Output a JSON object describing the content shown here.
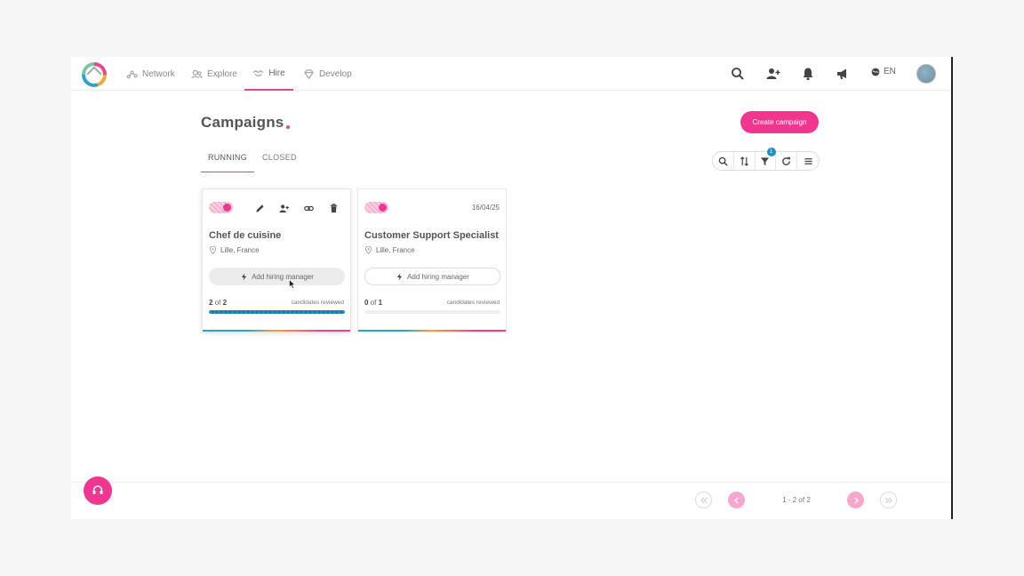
{
  "nav": {
    "items": [
      {
        "label": "Network",
        "icon": "network-icon"
      },
      {
        "label": "Explore",
        "icon": "users-icon"
      },
      {
        "label": "Hire",
        "icon": "handshake-icon"
      },
      {
        "label": "Develop",
        "icon": "diamond-icon"
      }
    ],
    "active": "Hire",
    "language": "EN"
  },
  "page": {
    "title": "Campaigns",
    "create_button": "Create campaign",
    "tabs": [
      "RUNNING",
      "CLOSED"
    ],
    "active_tab": "RUNNING",
    "filter_count": "1"
  },
  "campaigns": [
    {
      "title": "Chef de cuisine",
      "location": "Lille, France",
      "active": true,
      "date": "",
      "hiring_manager_label": "Add hiring manager",
      "reviewed": "2",
      "total": "2",
      "reviewed_label": "candidates reviewed",
      "progress": 1.0
    },
    {
      "title": "Customer Support Specialist",
      "location": "Lille, France",
      "active": true,
      "date": "16/04/25",
      "hiring_manager_label": "Add hiring manager",
      "reviewed": "0",
      "total": "1",
      "reviewed_label": "candidates reviewed",
      "progress": 0.0
    }
  ],
  "pagination": {
    "text": "1 - 2 of 2",
    "of_word": "of"
  },
  "colors": {
    "accent": "#f0368f",
    "progress": "#1f8fc2"
  }
}
